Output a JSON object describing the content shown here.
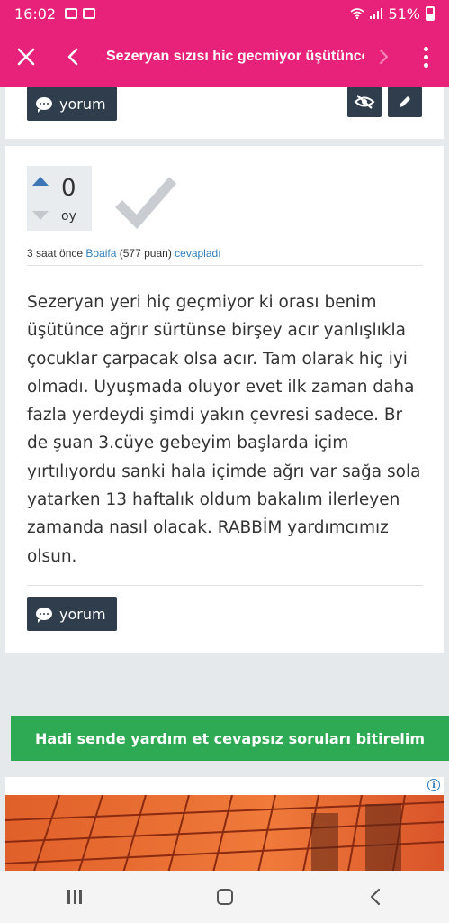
{
  "status_bar": {
    "time": "16:02",
    "battery": "51%",
    "battery_level": 0.51
  },
  "app_bar": {
    "title": "Sezeryan sızısı hic gecmiyor üşütünce",
    "close_icon": "close-icon",
    "back_icon": "chevron-left-icon",
    "forward_icon": "chevron-right-icon",
    "menu_icon": "more-vertical-icon"
  },
  "top_card": {
    "comment_label": "yorum"
  },
  "answer": {
    "votes": "0",
    "votes_label": "oy",
    "meta": {
      "time": "3 saat önce",
      "user": "Boaifa",
      "points": "(577 puan)",
      "action": "cevapladı"
    },
    "text": "Sezeryan yeri hiç geçmiyor ki orası benim üşütünce ağrır sürtünse birşey acır yanlışlıkla çocuklar çarpacak olsa acır. Tam olarak hiç iyi olmadı. Uyuşmada oluyor evet ilk zaman daha fazla yerdeydi şimdi yakın çevresi sadece. Br de şuan 3.cüye gebeyim başlarda içim yırtılıyordu sanki hala içimde ağrı var sağa sola yatarken 13 haftalık oldum bakalım ilerleyen zamanda nasıl olacak. RABBİM yardımcımız olsun.",
    "comment_label": "yorum"
  },
  "cta": {
    "label": "Hadi sende yardım et cevapsız soruları bitirelim"
  },
  "colors": {
    "brand": "#e8227a",
    "button_dark": "#2f3d4c",
    "cta_green": "#2eaa54",
    "link": "#2f7fbd",
    "vote_up": "#3b78b5"
  }
}
